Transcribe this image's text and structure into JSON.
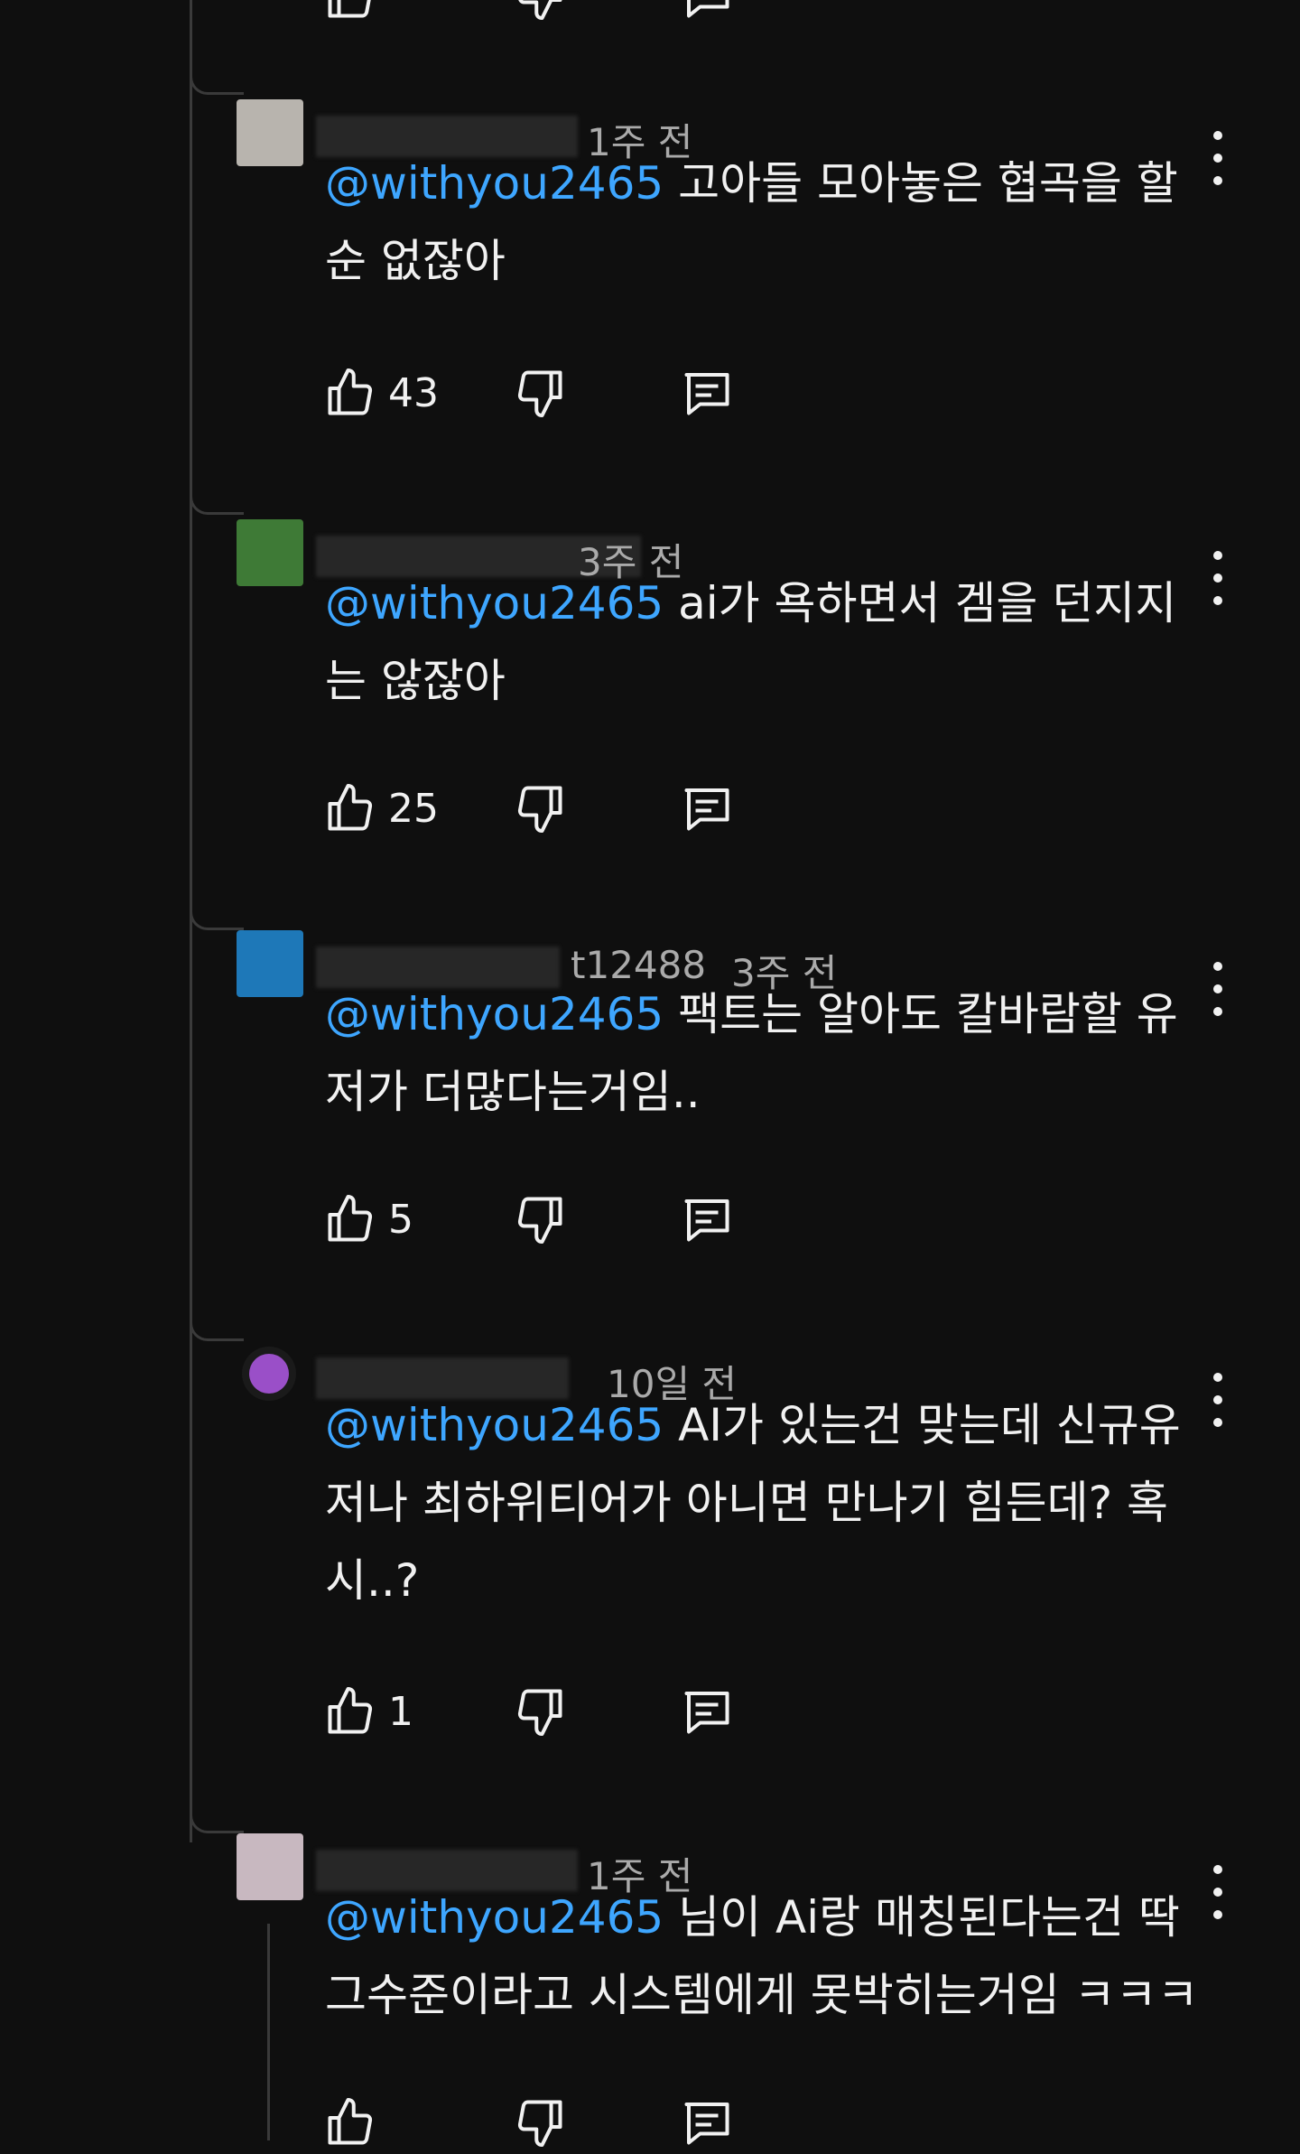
{
  "comments": [
    {
      "time": "1주 전",
      "mention": "@withyou2465",
      "text": " 고아들 모아놓은 협곡을 할 순 없잖아",
      "likes": "43",
      "avatar_color": "#b8b4ae"
    },
    {
      "time": "3주 전",
      "mention": "@withyou2465",
      "text": "  ai가 욕하면서 겜을 던지지는 않잖아",
      "likes": "25",
      "avatar_color": "#3e7a36"
    },
    {
      "time": "3주 전",
      "handle_fragment": "t12488",
      "mention": "@withyou2465",
      "text": " 팩트는 알아도 칼바람할 유저가 더많다는거임..",
      "likes": "5",
      "avatar_color": "#1e78b8"
    },
    {
      "time": "10일 전",
      "mention": "@withyou2465",
      "text": " AI가 있는건 맞는데 신규유저나 최하위티어가 아니면 만나기 힘든데? 혹시..?",
      "likes": "1",
      "avatar_color": "#9a4fc8"
    },
    {
      "time": "1주 전",
      "mention": "@withyou2465",
      "text": " 님이 Ai랑 매칭된다는건 딱 그수준이라고  시스템에게 못박히는거임 ㅋㅋㅋ",
      "likes": "",
      "avatar_color": "#c8b8c0"
    }
  ],
  "icons": {
    "like": "thumbs-up-icon",
    "dislike": "thumbs-down-icon",
    "reply": "comment-icon",
    "more": "more-vertical-icon"
  },
  "colors": {
    "background": "#0f0f0f",
    "mention": "#3ea6ff",
    "meta": "#aaaaaa"
  }
}
